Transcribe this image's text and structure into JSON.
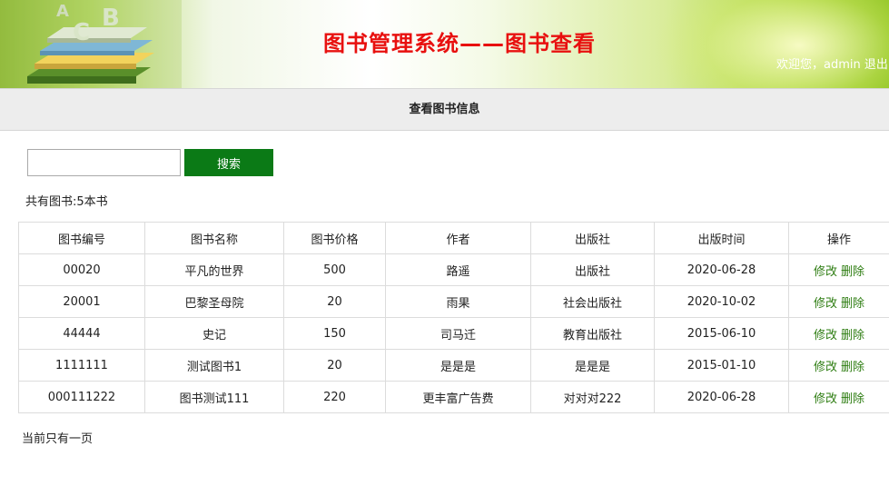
{
  "header": {
    "title": "图书管理系统——图书查看",
    "welcome": "欢迎您，admin",
    "logout": "退出",
    "logo_letters": [
      "C",
      "B",
      "A"
    ]
  },
  "subheader": {
    "title": "查看图书信息"
  },
  "search": {
    "value": "",
    "placeholder": "",
    "button_label": "搜索"
  },
  "summary": {
    "count_text": "共有图书:5本书"
  },
  "table": {
    "columns": [
      "图书编号",
      "图书名称",
      "图书价格",
      "作者",
      "出版社",
      "出版时间",
      "操作"
    ],
    "rows": [
      {
        "id": "00020",
        "name": "平凡的世界",
        "price": "500",
        "author": "路遥",
        "publisher": "出版社",
        "date": "2020-06-28"
      },
      {
        "id": "20001",
        "name": "巴黎圣母院",
        "price": "20",
        "author": "雨果",
        "publisher": "社会出版社",
        "date": "2020-10-02"
      },
      {
        "id": "44444",
        "name": "史记",
        "price": "150",
        "author": "司马迁",
        "publisher": "教育出版社",
        "date": "2015-06-10"
      },
      {
        "id": "1111111",
        "name": "测试图书1",
        "price": "20",
        "author": "是是是",
        "publisher": "是是是",
        "date": "2015-01-10"
      },
      {
        "id": "000111222",
        "name": "图书测试111",
        "price": "220",
        "author": "更丰富广告费",
        "publisher": "对对对222",
        "date": "2020-06-28"
      }
    ],
    "action_edit": "修改",
    "action_delete": "删除"
  },
  "pager": {
    "text": "当前只有一页"
  },
  "colors": {
    "title_red": "#e8100f",
    "button_green": "#0b7a16",
    "link_green": "#2e7d12",
    "banner_green": "#8cc21e"
  }
}
